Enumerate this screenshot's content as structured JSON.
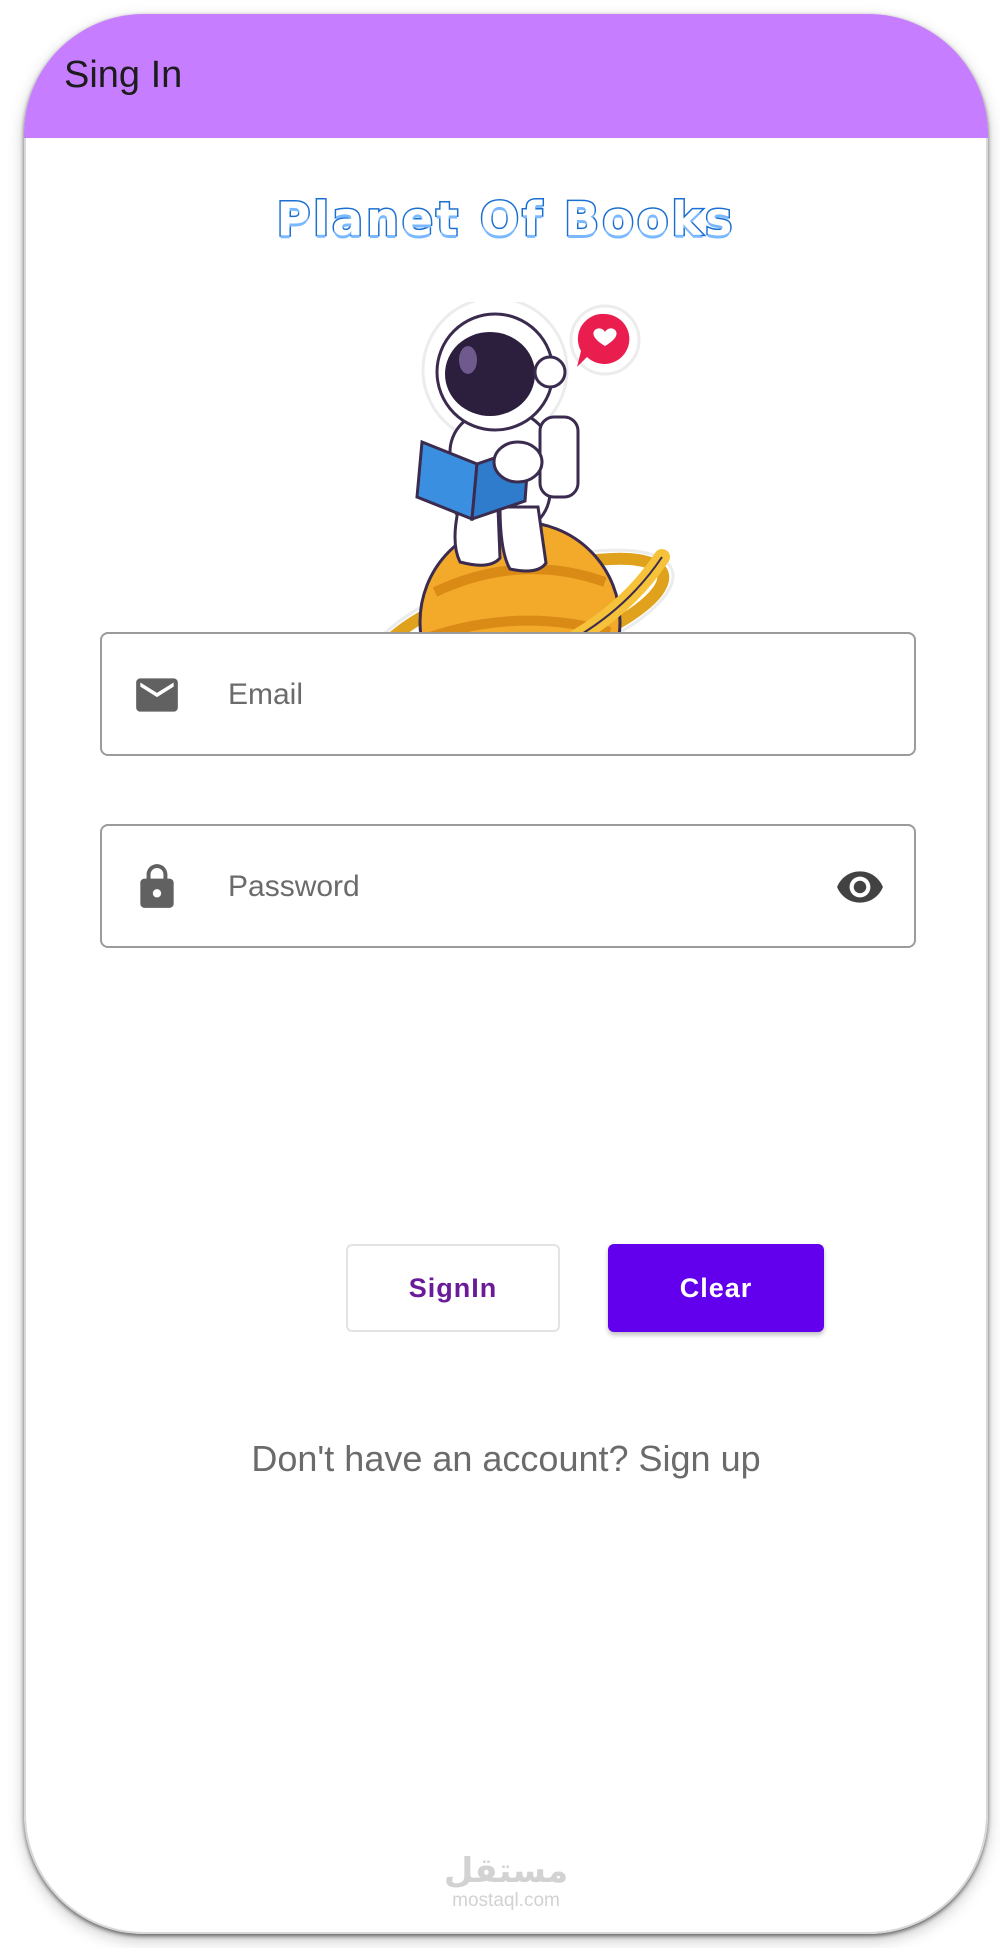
{
  "appbar": {
    "title": "Sing In",
    "color": "#c77dff"
  },
  "brand": {
    "title": "Planet Of Books"
  },
  "form": {
    "email": {
      "placeholder": "Email",
      "icon": "mail-icon"
    },
    "password": {
      "placeholder": "Password",
      "lead_icon": "lock-icon",
      "trail_icon": "eye-icon"
    }
  },
  "buttons": {
    "signin_label": "SignIn",
    "clear_label": "Clear",
    "accent": "#6200ee"
  },
  "footer": {
    "signup_text": "Don't have an account? Sign up"
  },
  "watermark": {
    "arabic": "مستقل",
    "url": "mostaql.com"
  }
}
